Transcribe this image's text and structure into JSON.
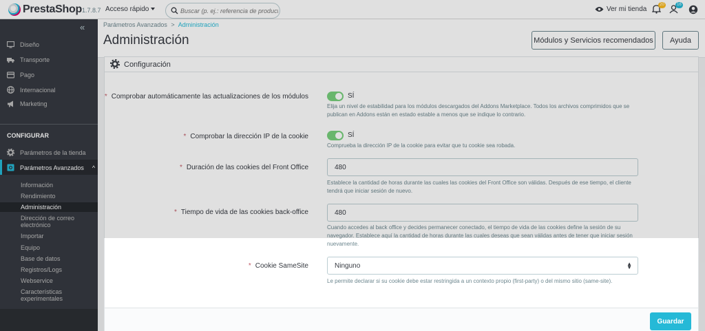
{
  "header": {
    "logo_text": "PrestaShop",
    "version": "1.7.8.7",
    "quick_access": "Acceso rápido",
    "search_placeholder": "Buscar (p. ej.: referencia de producto,",
    "view_shop": "Ver mi tienda",
    "orders_badge": "20",
    "customers_badge": "16"
  },
  "sidebar": {
    "items": [
      {
        "label": "Diseño",
        "icon": "monitor-icon"
      },
      {
        "label": "Transporte",
        "icon": "truck-icon"
      },
      {
        "label": "Pago",
        "icon": "credit-card-icon"
      },
      {
        "label": "Internacional",
        "icon": "globe-icon"
      },
      {
        "label": "Marketing",
        "icon": "megaphone-icon"
      }
    ],
    "section": "CONFIGURAR",
    "config_items": [
      {
        "label": "Parámetros de la tienda",
        "icon": "gear-icon"
      },
      {
        "label": "Parámetros Avanzados",
        "icon": "advanced-settings-icon"
      }
    ],
    "sub_items": [
      "Información",
      "Rendimiento",
      "Administración",
      "Dirección de correo electrónico",
      "Importar",
      "Equipo",
      "Base de datos",
      "Registros/Logs",
      "Webservice",
      "Características experimentales"
    ]
  },
  "toolbar": {
    "breadcrumb_parent": "Parámetros Avanzados",
    "breadcrumb_separator": ">",
    "breadcrumb_current": "Administración",
    "title": "Administración",
    "modules_button": "Módulos y Servicios recomendados",
    "help_button": "Ayuda"
  },
  "panel": {
    "title": "Configuración",
    "fields": [
      {
        "label": "Comprobar automáticamente las actualizaciones de los módulos",
        "value": "SÍ",
        "help": "Elija un nivel de estabilidad para los módulos descargados del Addons Marketplace. Todos los archivos comprimidos que se publican en Addons están en estado estable a menos que se indique lo contrario."
      },
      {
        "label": "Comprobar la dirección IP de la cookie",
        "value": "SÍ",
        "help": "Comprueba la dirección IP de la cookie para evitar que tu cookie sea robada."
      },
      {
        "label": "Duración de las cookies del Front Office",
        "value": "480",
        "help": "Establece la cantidad de horas durante las cuales las cookies del Front Office son válidas. Después de ese tiempo, el cliente tendrá que iniciar sesión de nuevo."
      },
      {
        "label": "Tiempo de vida de las cookies back-office",
        "value": "480",
        "help": "Cuando accedes al back office y decides permanecer conectado, el tiempo de vida de las cookies define la sesión de su navegador. Establece aquí la cantidad de horas durante las cuales deseas que sean válidas antes de tener que iniciar sesión nuevamente."
      },
      {
        "label": "Cookie SameSite",
        "value": "Ninguno",
        "help": "Le permite declarar si su cookie debe estar restringida a un contexto propio (first-party) o del mismo sitio (same-site)."
      }
    ],
    "required_mark": "*",
    "save_button": "Guardar"
  },
  "colors": {
    "accent": "#25b9d7",
    "sidebar_bg": "#363a41",
    "switch_on": "#78d07d",
    "required": "#c05c67",
    "orders_badge": "#fbbb22",
    "customers_badge": "#25b9d7"
  }
}
